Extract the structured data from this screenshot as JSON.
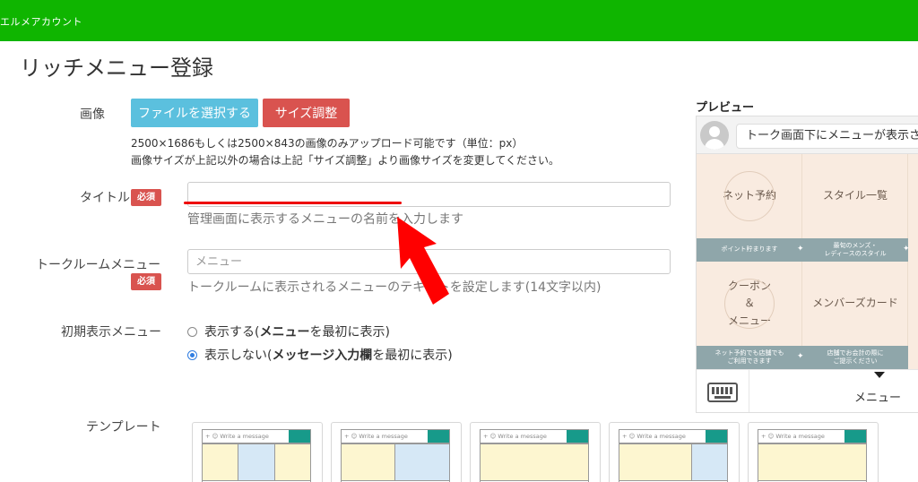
{
  "header": {
    "brand": "エルメアカウント",
    "bar_color": "#0fb500"
  },
  "page": {
    "title": "リッチメニュー登録"
  },
  "image_field": {
    "label": "画像",
    "file_button": "ファイルを選択する",
    "size_button": "サイズ調整",
    "note_line1": "2500×1686もしくは2500×843の画像のみアップロード可能です（単位：px）",
    "note_line2": "画像サイズが上記以外の場合は上記「サイズ調整」より画像サイズを変更してください。"
  },
  "title_field": {
    "label": "タイトル",
    "required": "必須",
    "value": "",
    "help": "管理画面に表示するメニューの名前を入力します"
  },
  "talkroom_field": {
    "label": "トークルームメニュー",
    "required": "必須",
    "placeholder": "メニュー",
    "help": "トークルームに表示されるメニューのテキストを設定します(14文字以内)"
  },
  "initial_display": {
    "label": "初期表示メニュー",
    "options": [
      {
        "prefix": "表示する(",
        "bold": "メニュー",
        "suffix": "を最初に表示)",
        "selected": false
      },
      {
        "prefix": "表示しない(",
        "bold": "メッセージ入力欄",
        "suffix": "を最初に表示)",
        "selected": true
      }
    ]
  },
  "preview": {
    "title": "プレビュー",
    "chat_text": "トーク画面下にメニューが表示さ",
    "cells": [
      {
        "label": "ネット予約",
        "strip": "ポイント貯まります"
      },
      {
        "label": "スタイル一覧",
        "strip": "最旬のメンズ・\nレディースのスタイル"
      },
      {
        "label": "クーポン\n＆\nメニュー",
        "strip": "ネット予約でも店舗でも\nご利用できます"
      },
      {
        "label": "メンバーズカード",
        "strip": "店舗でお会計の際に\nご提示ください"
      }
    ],
    "menu_label": "メニュー",
    "bg_color": "#f9ebe0",
    "strip_color": "#8fa6aa"
  },
  "templates": {
    "label": "テンプレート",
    "bar_text": "+ ☺ Write a message"
  },
  "colors": {
    "accent_blue": "#5bc0de",
    "accent_red": "#d9534f",
    "arrow_red": "#ff0000"
  }
}
